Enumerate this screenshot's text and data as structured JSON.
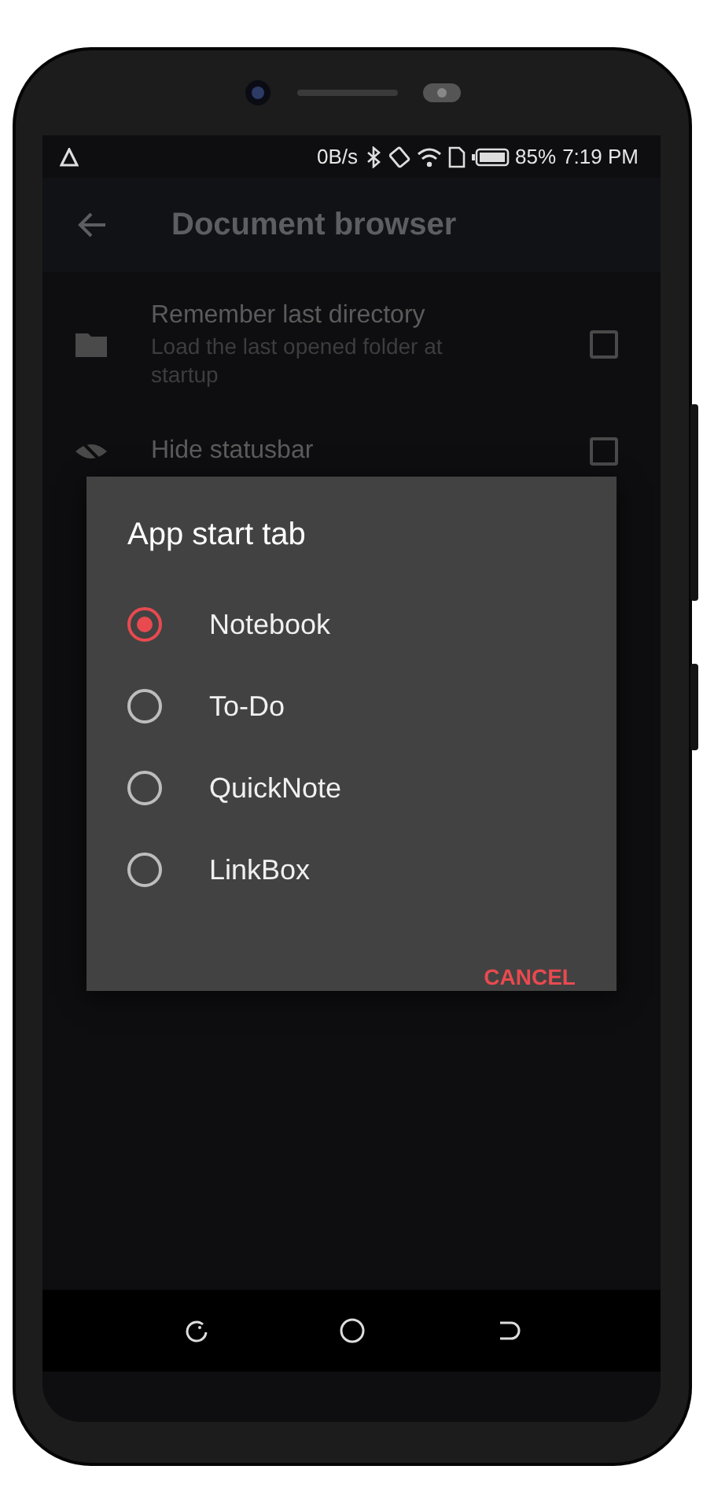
{
  "status_bar": {
    "speed": "0B/s",
    "battery": "85%",
    "time": "7:19 PM"
  },
  "app_bar": {
    "title": "Document browser"
  },
  "settings": [
    {
      "kind": "folder",
      "title": "Remember last directory",
      "subtitle": "Load the last opened folder at startup",
      "checked": false
    },
    {
      "kind": "eye",
      "title": "Hide statusbar",
      "checked": false
    }
  ],
  "dialog": {
    "title": "App start tab",
    "options": [
      {
        "label": "Notebook",
        "selected": true
      },
      {
        "label": "To-Do",
        "selected": false
      },
      {
        "label": "QuickNote",
        "selected": false
      },
      {
        "label": "LinkBox",
        "selected": false
      }
    ],
    "buttons": [
      "CANCEL"
    ]
  }
}
